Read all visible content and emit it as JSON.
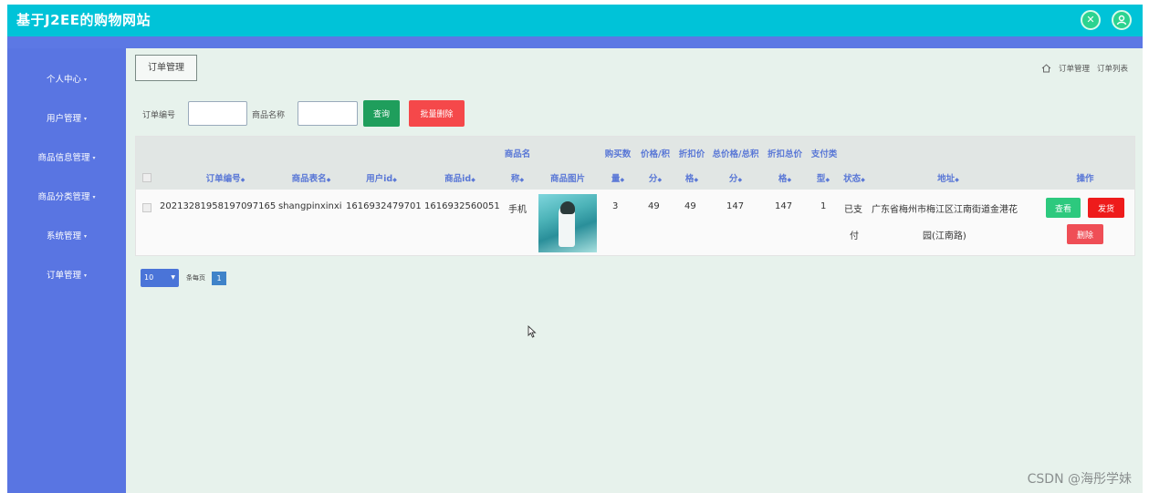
{
  "app": {
    "title": "基于J2EE的购物网站",
    "header_icons": [
      "shrink-icon",
      "user-icon"
    ]
  },
  "sidebar": {
    "items": [
      {
        "label": "个人中心"
      },
      {
        "label": "用户管理"
      },
      {
        "label": "商品信息管理"
      },
      {
        "label": "商品分类管理"
      },
      {
        "label": "系统管理"
      },
      {
        "label": "订单管理"
      }
    ]
  },
  "page": {
    "title": "订单管理",
    "breadcrumb": [
      "订单管理",
      "订单列表"
    ]
  },
  "search": {
    "order_no_label": "订单编号",
    "order_no_value": "",
    "product_name_label": "商品名称",
    "product_name_value": "",
    "query_button": "查询",
    "batch_delete_button": "批量删除"
  },
  "table": {
    "headers": {
      "order_no": "订单编号",
      "table_name": "商品表名",
      "user_id": "用户id",
      "product_id": "商品id",
      "product_name_top": "商品名",
      "product_name_bottom": "称",
      "product_image": "商品图片",
      "quantity_top": "购买数",
      "quantity_bottom": "量",
      "price_points_top": "价格/积",
      "price_points_bottom": "分",
      "discount_price_top": "折扣价",
      "discount_price_bottom": "格",
      "total_price_top": "总价格/总积",
      "total_price_bottom": "分",
      "discount_total_top": "折扣总价",
      "discount_total_bottom": "格",
      "pay_type_top": "支付类",
      "pay_type_bottom": "型",
      "status": "状态",
      "address": "地址",
      "actions": "操作"
    },
    "rows": [
      {
        "order_no": "20213281958197097165",
        "table_name": "shangpinxinxi",
        "user_id": "1616932479701",
        "product_id": "1616932560051",
        "product_name": "手机",
        "quantity": "3",
        "price": "49",
        "discount_price": "49",
        "total_price": "147",
        "discount_total": "147",
        "pay_type": "1",
        "status_line1": "已支",
        "status_line2": "付",
        "address_line1": "广东省梅州市梅江区江南街道金港花",
        "address_line2": "园(江南路)",
        "view_button": "查看",
        "ship_button": "发货",
        "delete_button": "删除"
      }
    ]
  },
  "pagination": {
    "page_size": "10",
    "per_page_label": "条每页",
    "current_page": "1"
  },
  "watermark": "CSDN @海彤学妹",
  "colors": {
    "topbar": "#00c3d8",
    "sidebar": "#5975e2",
    "main_bg": "#e7f2ec",
    "query_button": "#1f9e5c",
    "batch_delete_button": "#f5484a",
    "view_button": "#2dc97e",
    "ship_button": "#ee1b1b",
    "delete_button": "#ef4e56",
    "header_text": "#5a78d6"
  }
}
